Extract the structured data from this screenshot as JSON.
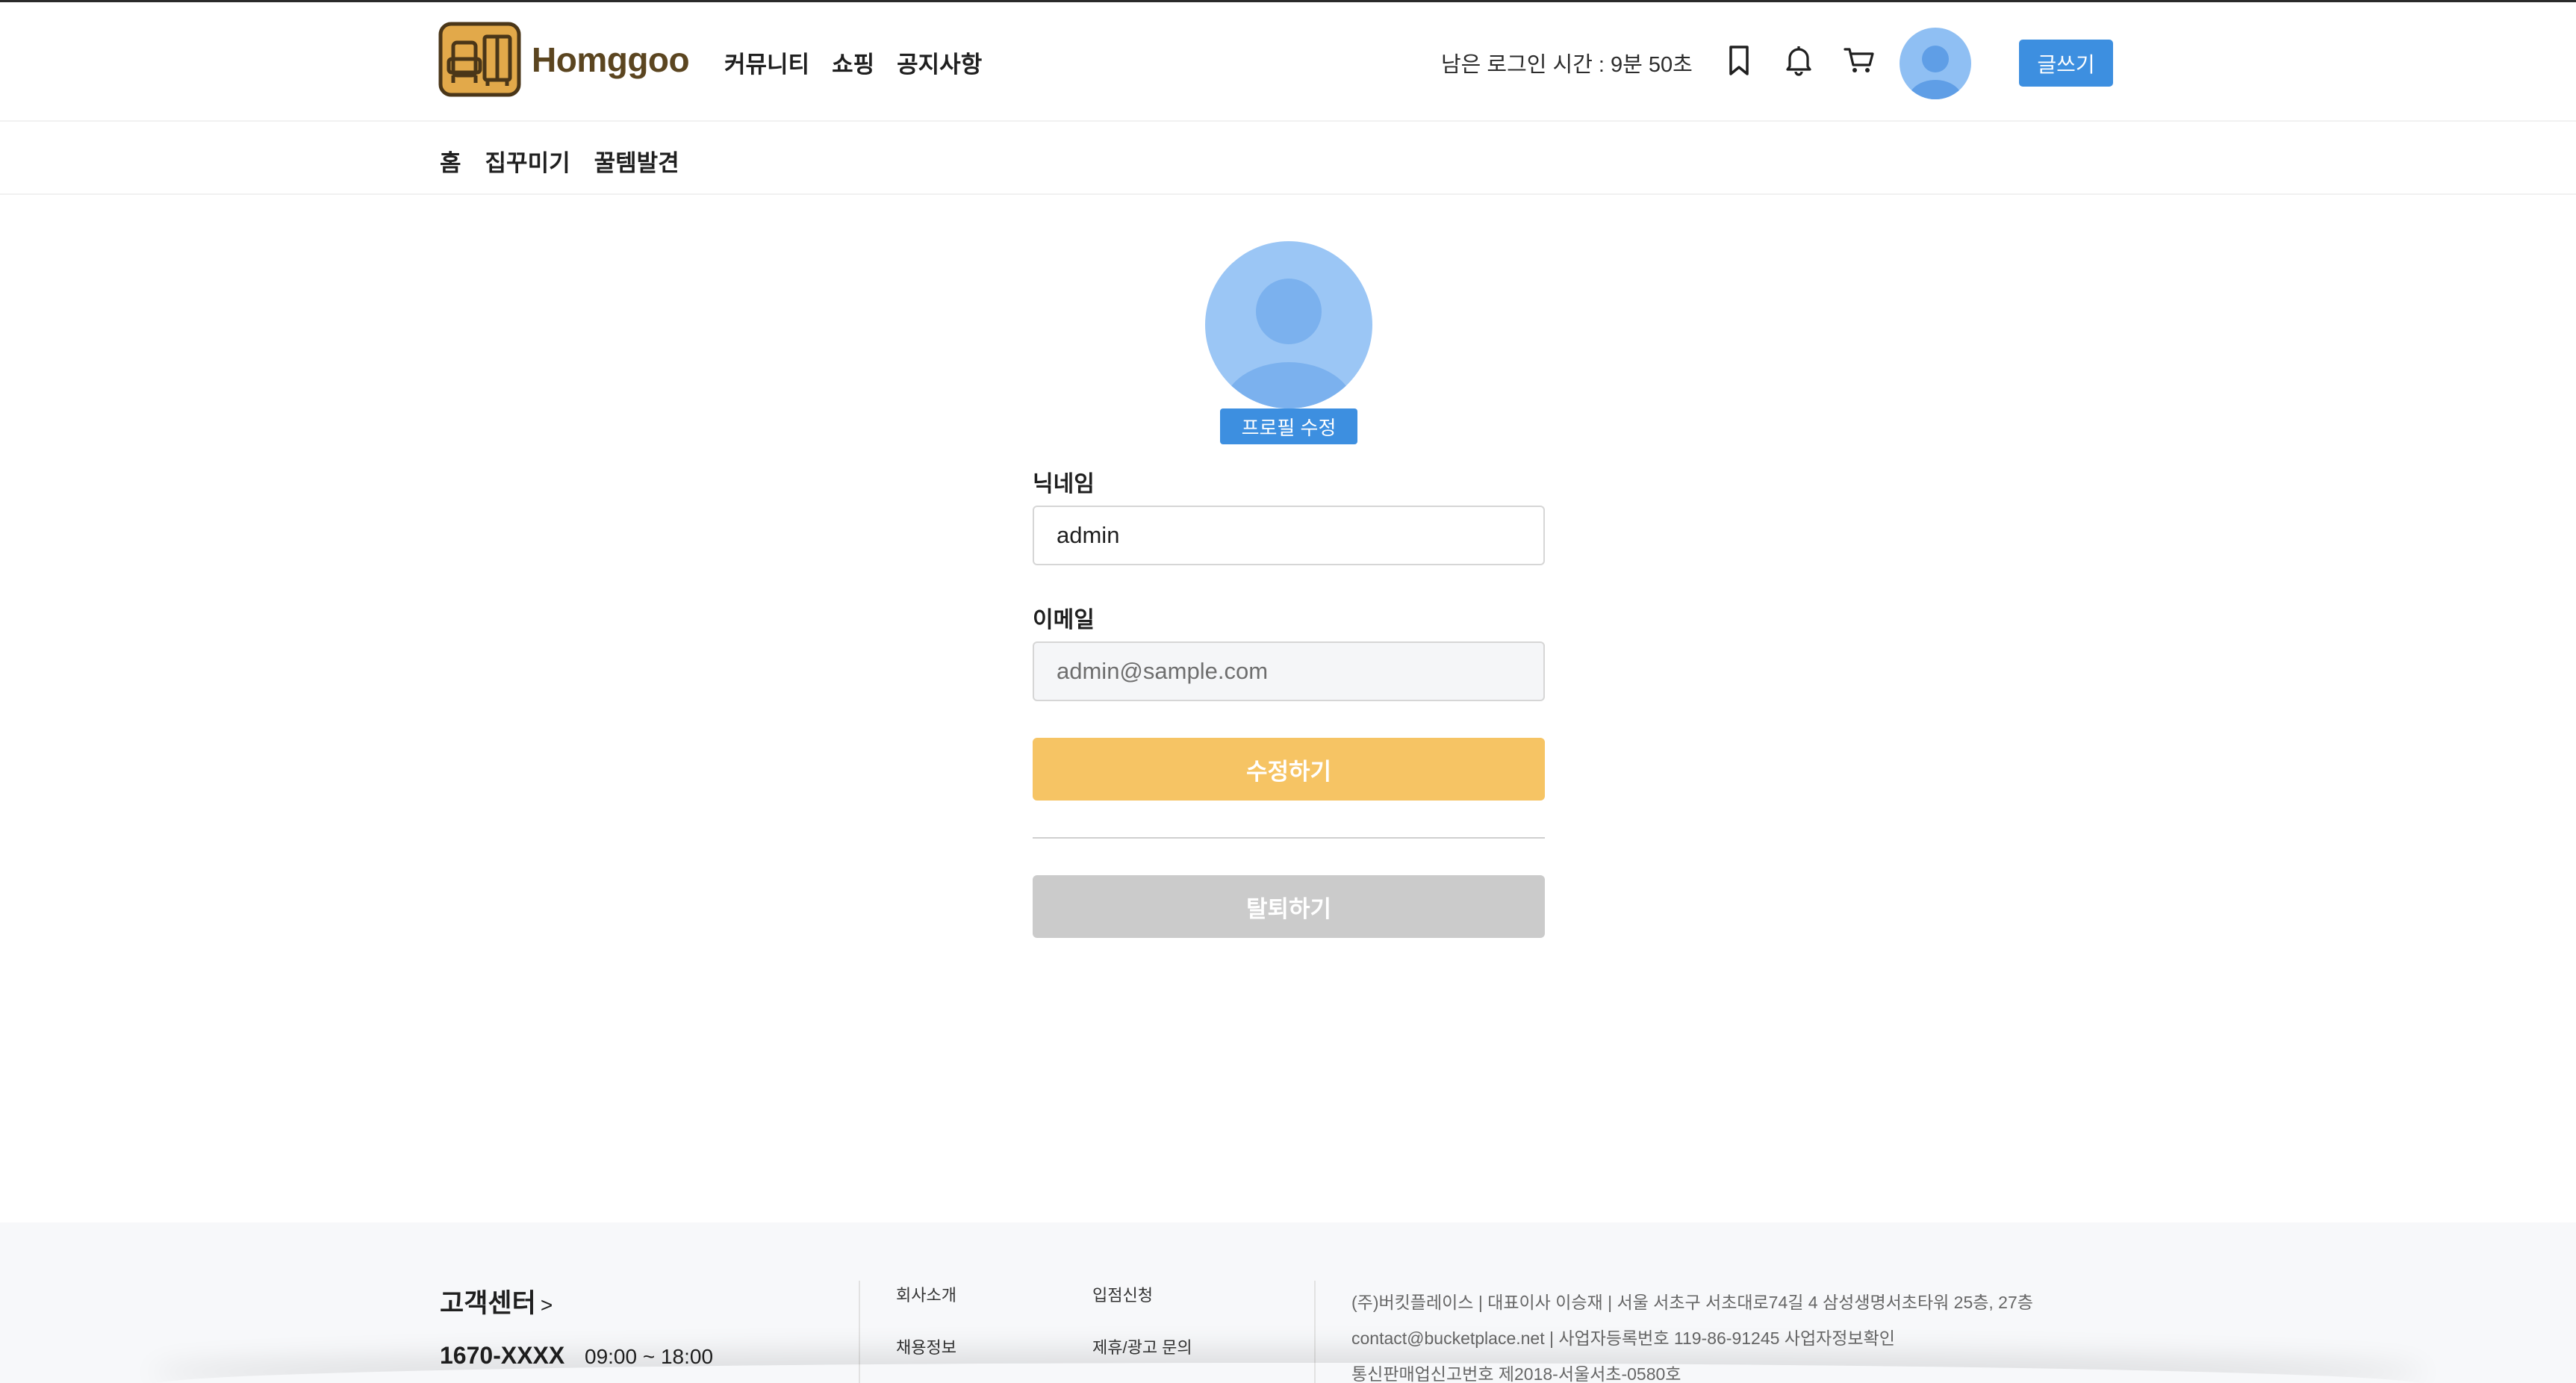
{
  "header": {
    "logo_text": "Homggoo",
    "nav": [
      "커뮤니티",
      "쇼핑",
      "공지사항"
    ],
    "login_timer": "남은 로그인 시간 : 9분 50초",
    "write_button": "글쓰기",
    "icons": [
      "bookmark-icon",
      "bell-icon",
      "cart-icon",
      "avatar"
    ]
  },
  "sub_nav": [
    "홈",
    "집꾸미기",
    "꿀템발견"
  ],
  "profile": {
    "edit_profile_button": "프로필 수정",
    "nickname_label": "닉네임",
    "nickname_value": "admin",
    "email_label": "이메일",
    "email_value": "admin@sample.com",
    "submit_button": "수정하기",
    "withdraw_button": "탈퇴하기"
  },
  "footer": {
    "cs_title": "고객센터",
    "cs_arrow": ">",
    "phone": "1670-XXXX",
    "hours": "09:00 ~ 18:00",
    "links": [
      "회사소개",
      "입점신청",
      "채용정보",
      "제휴/광고 문의"
    ],
    "company_lines": [
      "(주)버킷플레이스 | 대표이사 이승재 | 서울 서초구 서초대로74길 4 삼성생명서초타워 25층, 27층",
      "contact@bucketplace.net | 사업자등록번호 119-86-91245 사업자정보확인",
      "통신판매업신고번호 제2018-서울서초-0580호"
    ]
  },
  "colors": {
    "accent_blue": "#3d8fe0",
    "submit_yellow": "#f6c464",
    "withdraw_gray": "#cbcbcb",
    "logo_brown": "#5b4520",
    "logo_gold": "#e2a94a",
    "avatar_blue": "#9bc6f5"
  }
}
